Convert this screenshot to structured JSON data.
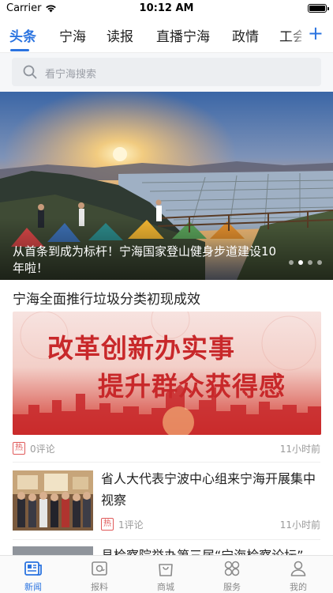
{
  "status_bar": {
    "carrier": "Carrier",
    "time": "10:12 AM"
  },
  "tabs": [
    {
      "label": "头条",
      "active": true
    },
    {
      "label": "宁海"
    },
    {
      "label": "读报"
    },
    {
      "label": "直播宁海"
    },
    {
      "label": "政情"
    },
    {
      "label": "工会"
    }
  ],
  "add_tab_icon": "plus-icon",
  "search": {
    "placeholder": "看宁海搜索"
  },
  "banner": {
    "caption": "从首条到成为标杆！宁海国家登山健身步道建设10年啦！",
    "slide_count": 4,
    "active_slide": 2
  },
  "articles": [
    {
      "title": "宁海全面推行垃圾分类初现成效",
      "image_text": [
        "改革创新办实事",
        "提升群众获得感"
      ],
      "badge": "热",
      "comments": "0评论",
      "time": "11小时前"
    },
    {
      "title": "省人大代表宁波中心组来宁海开展集中视察",
      "badge": "热",
      "comments": "1评论",
      "time": "11小时前"
    },
    {
      "title": "县检察院举办第三届“宁海检察论坛”"
    }
  ],
  "bottom_nav": [
    {
      "label": "新闻",
      "icon": "newspaper-icon",
      "active": true
    },
    {
      "label": "报料",
      "icon": "report-icon"
    },
    {
      "label": "商城",
      "icon": "shopping-bag-icon"
    },
    {
      "label": "服务",
      "icon": "services-grid-icon"
    },
    {
      "label": "我的",
      "icon": "profile-icon"
    }
  ],
  "colors": {
    "accent": "#2a73e0",
    "hot": "#e05a5a",
    "banner_red": "#c8282a"
  }
}
